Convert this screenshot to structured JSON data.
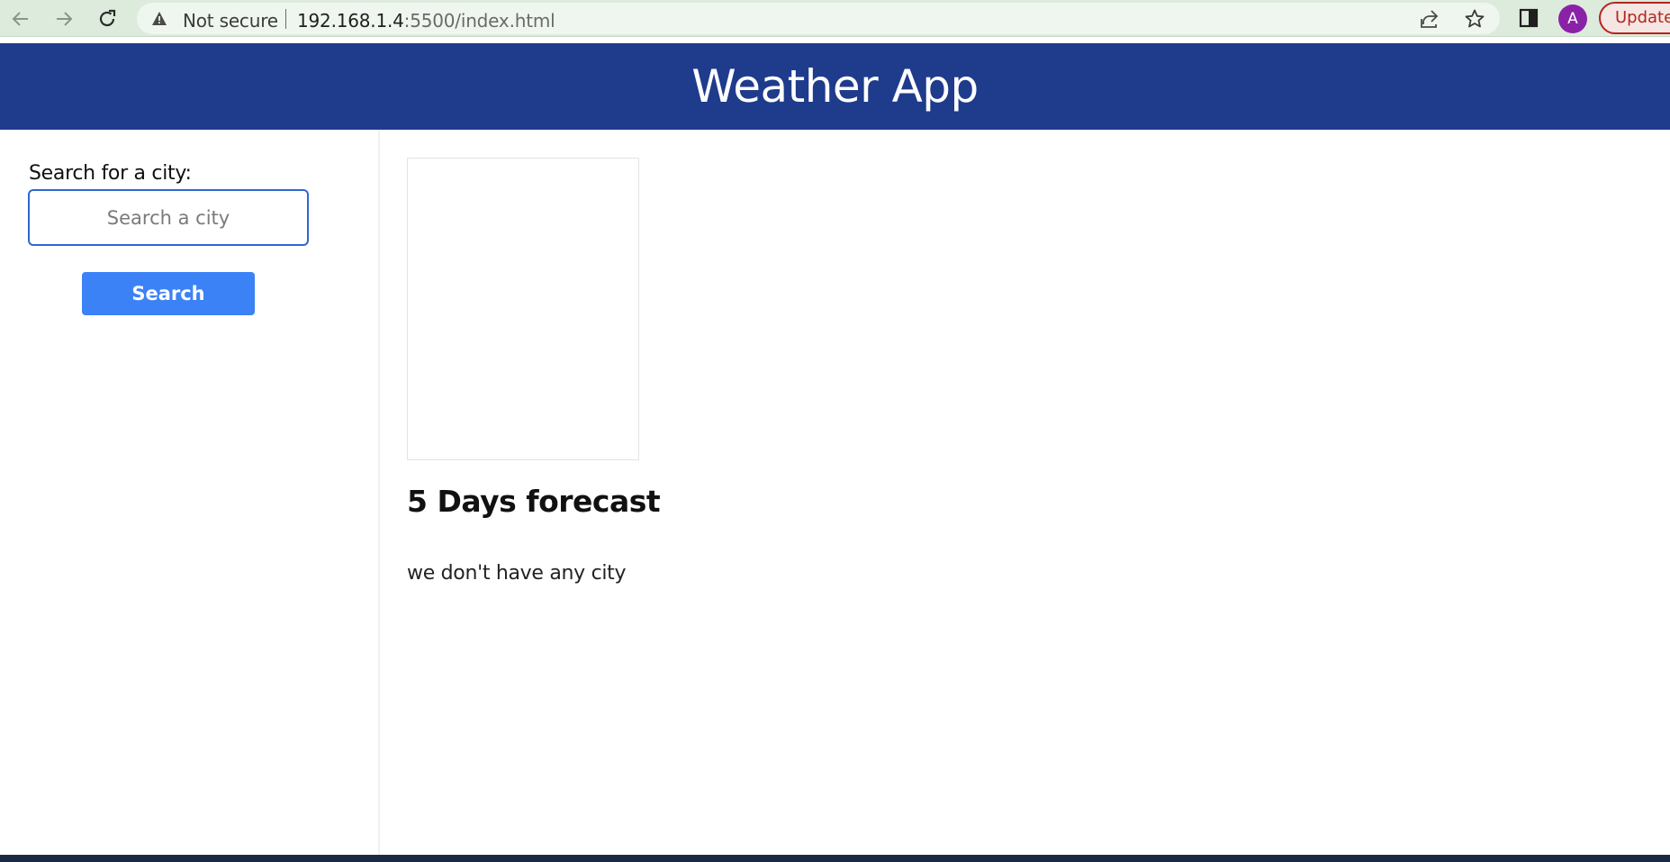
{
  "browser": {
    "security_label": "Not secure",
    "url_host": "192.168.1.4",
    "url_path": ":5500/index.html",
    "profile_initial": "A",
    "update_label": "Update",
    "icons": {
      "back": "arrow-left-icon",
      "forward": "arrow-right-icon",
      "reload": "reload-icon",
      "warning": "warning-triangle-icon",
      "share": "share-icon",
      "bookmark": "star-icon",
      "side_panel": "side-panel-icon"
    }
  },
  "header": {
    "title": "Weather App",
    "background_color": "#1f3b8c"
  },
  "sidebar": {
    "search_label": "Search for a city:",
    "search_placeholder": "Search a city",
    "search_value": "",
    "search_button_label": "Search",
    "button_color": "#3b82f6"
  },
  "main": {
    "forecast_title": "5 Days forecast",
    "empty_message": "we don't have any city"
  }
}
